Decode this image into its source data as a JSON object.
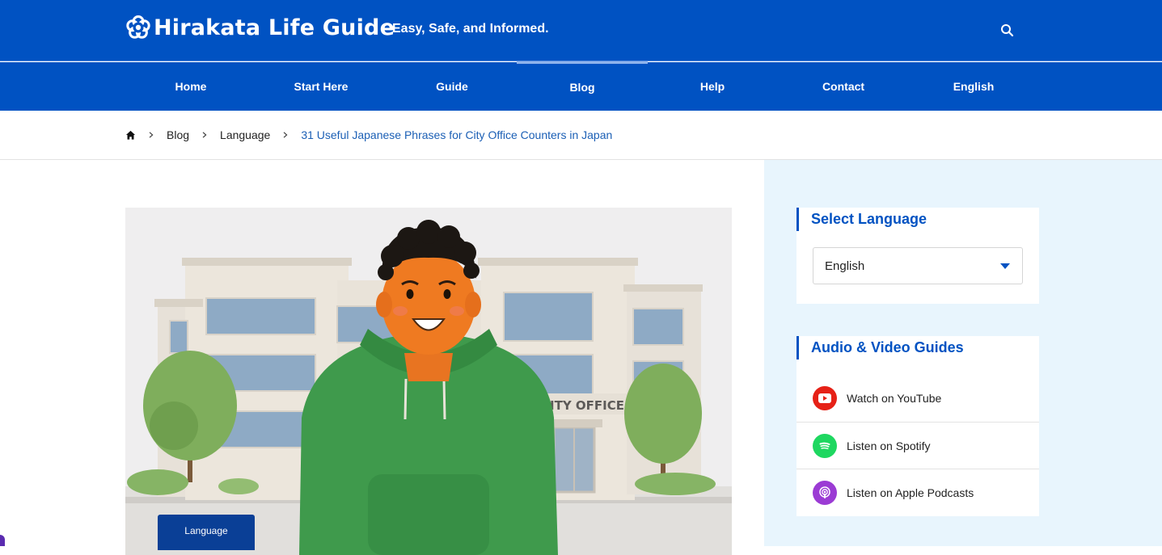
{
  "header": {
    "logo_text": "Hirakata Life Guide",
    "tagline": "Easy, Safe, and Informed.",
    "search_icon": "search-icon",
    "colors": {
      "brand": "#0052c2",
      "accent_light": "#e8f5fd"
    }
  },
  "nav": {
    "items": [
      {
        "label": "Home"
      },
      {
        "label": "Start Here"
      },
      {
        "label": "Guide"
      },
      {
        "label": "Blog"
      },
      {
        "label": "Help"
      },
      {
        "label": "Contact"
      },
      {
        "label": "English"
      }
    ],
    "active": "Blog"
  },
  "breadcrumb": {
    "home_icon": "home-icon",
    "items": [
      "Blog",
      "Language"
    ],
    "current": "31 Useful Japanese Phrases for City Office Counters in Japan"
  },
  "hero": {
    "sign_text": "CITY OFFICE",
    "category_badge": "Language"
  },
  "sidebar": {
    "language_widget": {
      "title": "Select Language",
      "selected": "English"
    },
    "media_widget": {
      "title": "Audio & Video Guides",
      "items": [
        {
          "label": "Watch on YouTube",
          "icon": "youtube-icon",
          "color": "#e62117"
        },
        {
          "label": "Listen on Spotify",
          "icon": "spotify-icon",
          "color": "#1ed760"
        },
        {
          "label": "Listen on Apple Podcasts",
          "icon": "podcast-icon",
          "color": "#9b3bd4"
        }
      ]
    }
  }
}
